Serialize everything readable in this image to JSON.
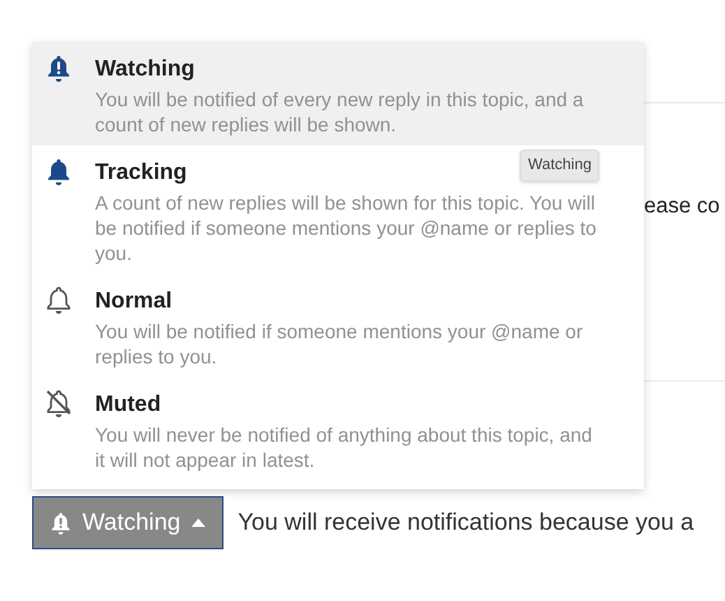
{
  "notification_menu": {
    "items": [
      {
        "kind": "watching",
        "title": "Watching",
        "description": "You will be notified of every new reply in this topic, and a count of new replies will be shown.",
        "selected": true
      },
      {
        "kind": "tracking",
        "title": "Tracking",
        "description": "A count of new replies will be shown for this topic. You will be notified if someone mentions your @name or replies to you.",
        "selected": false,
        "tooltip": "Watching"
      },
      {
        "kind": "normal",
        "title": "Normal",
        "description": "You will be notified if someone mentions your @name or replies to you.",
        "selected": false
      },
      {
        "kind": "muted",
        "title": "Muted",
        "description": "You will never be notified of anything about this topic, and it will not appear in latest.",
        "selected": false
      }
    ]
  },
  "background_text": "ease co",
  "notification_button": {
    "kind": "watching",
    "label": "Watching"
  },
  "notification_reason": "You will receive notifications because you a"
}
